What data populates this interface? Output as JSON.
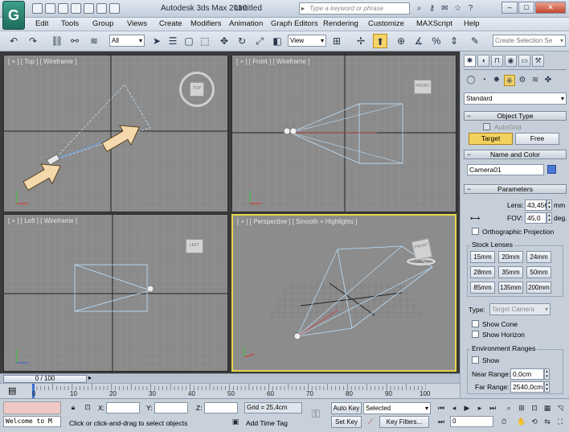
{
  "window": {
    "app_title": "Autodesk 3ds Max 2010",
    "file_title": "Untitled",
    "search_placeholder": "Type a keyword or phrase",
    "logo_glyph": "G"
  },
  "menu": [
    "Edit",
    "Tools",
    "Group",
    "Views",
    "Create",
    "Modifiers",
    "Animation",
    "Graph Editors",
    "Rendering",
    "Customize",
    "MAXScript",
    "Help"
  ],
  "toolbar": {
    "selection_filter": "All",
    "reference_coord": "View",
    "named_selection_placeholder": "Create Selection Se"
  },
  "viewports": {
    "top": {
      "label": "[ + ] [ Top ] [ Wireframe ]",
      "cube": "TOP"
    },
    "front": {
      "label": "[ + ] [ Front ] [ Wireframe ]",
      "cube": "FRONT"
    },
    "left": {
      "label": "[ + ] [ Left ] [ Wireframe ]",
      "cube": "LEFT"
    },
    "perspective": {
      "label": "[ + ] [ Perspective ] [ Smooth + Highlights ]",
      "cube": "FRONT"
    }
  },
  "command_panel": {
    "category": "Standard",
    "object_type": {
      "title": "Object Type",
      "autogrid": "AutoGrid",
      "buttons": [
        "Target",
        "Free"
      ]
    },
    "name_color": {
      "title": "Name and Color",
      "name": "Camera01",
      "color": "#4a76d6"
    },
    "parameters": {
      "title": "Parameters",
      "lens_label": "Lens:",
      "lens_value": "43,456",
      "lens_unit": "mm",
      "fov_label": "FOV:",
      "fov_value": "45,0",
      "fov_unit": "deg.",
      "ortho": "Orthographic Projection",
      "stock_lenses_title": "Stock Lenses",
      "lenses": [
        "15mm",
        "20mm",
        "24mm",
        "28mm",
        "35mm",
        "50mm",
        "85mm",
        "135mm",
        "200mm"
      ],
      "type_label": "Type:",
      "type_value": "Target Camera",
      "show_cone": "Show Cone",
      "show_horizon": "Show Horizon",
      "env_title": "Environment Ranges",
      "show": "Show",
      "near_label": "Near Range:",
      "near_value": "0,0cm",
      "far_label": "Far Range:",
      "far_value": "2540,0cm"
    }
  },
  "timeline": {
    "slider": "0 / 100",
    "ticks": [
      "0",
      "10",
      "20",
      "30",
      "40",
      "50",
      "60",
      "70",
      "80",
      "90",
      "100"
    ]
  },
  "status": {
    "maxscript": "Welcome to M",
    "prompt": "Click or click-and-drag to select objects",
    "x_label": "X:",
    "y_label": "Y:",
    "z_label": "Z:",
    "grid": "Grid = 25,4cm",
    "add_time_tag": "Add Time Tag",
    "auto_key": "Auto Key",
    "set_key": "Set Key",
    "key_mode": "Selected",
    "key_filters": "Key Filters...",
    "frame": "0"
  }
}
